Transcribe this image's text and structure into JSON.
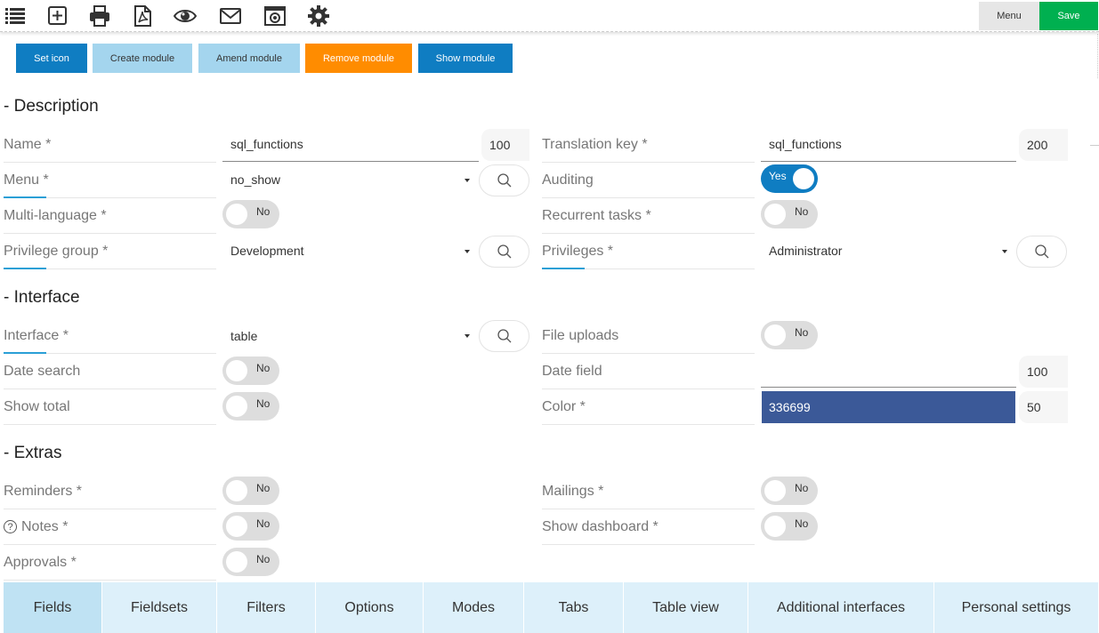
{
  "toolbar": {
    "icons": [
      "list-icon",
      "add-icon",
      "print-icon",
      "pdf-icon",
      "preview-icon",
      "mail-icon",
      "screenshot-icon",
      "settings-icon"
    ],
    "menu_label": "Menu",
    "save_label": "Save"
  },
  "actions": {
    "set_icon": "Set icon",
    "create_module": "Create module",
    "amend_module": "Amend module",
    "remove_module": "Remove module",
    "show_module": "Show module"
  },
  "colors": {
    "primary": "#0f7dc2",
    "light_blue": "#a4d5ee",
    "orange": "#ff8c00",
    "save_green": "#00b050",
    "color_field": "#3b5998",
    "tab_active": "#bfe2f3"
  },
  "sections": {
    "description": "- Description",
    "interface": "- Interface",
    "extras": "- Extras"
  },
  "fields": {
    "name_label": "Name *",
    "name_value": "sql_functions",
    "name_size": "100",
    "translation_key_label": "Translation key *",
    "translation_key_value": "sql_functions",
    "translation_key_size": "200",
    "menu_label": "Menu *",
    "menu_value": "no_show",
    "auditing_label": "Auditing",
    "auditing_value": "Yes",
    "multilanguage_label": "Multi-language *",
    "multilanguage_value": "No",
    "recurrent_tasks_label": "Recurrent tasks *",
    "recurrent_tasks_value": "No",
    "privilege_group_label": "Privilege group *",
    "privilege_group_value": "Development",
    "privileges_label": "Privileges *",
    "privileges_value": "Administrator",
    "interface_label": "Interface *",
    "interface_value": "table",
    "file_uploads_label": "File uploads",
    "file_uploads_value": "No",
    "date_search_label": "Date search",
    "date_search_value": "No",
    "date_field_label": "Date field",
    "date_field_value": "",
    "date_field_size": "100",
    "show_total_label": "Show total",
    "show_total_value": "No",
    "color_label": "Color *",
    "color_value": "336699",
    "color_size": "50",
    "reminders_label": "Reminders *",
    "reminders_value": "No",
    "mailings_label": "Mailings *",
    "mailings_value": "No",
    "notes_label": "Notes *",
    "notes_help": "?",
    "notes_value": "No",
    "show_dashboard_label": "Show dashboard *",
    "show_dashboard_value": "No",
    "approvals_label": "Approvals *",
    "approvals_value": "No"
  },
  "tabs": [
    "Fields",
    "Fieldsets",
    "Filters",
    "Options",
    "Modes",
    "Tabs",
    "Table view",
    "Additional interfaces",
    "Personal settings"
  ],
  "active_tab": "Fields"
}
